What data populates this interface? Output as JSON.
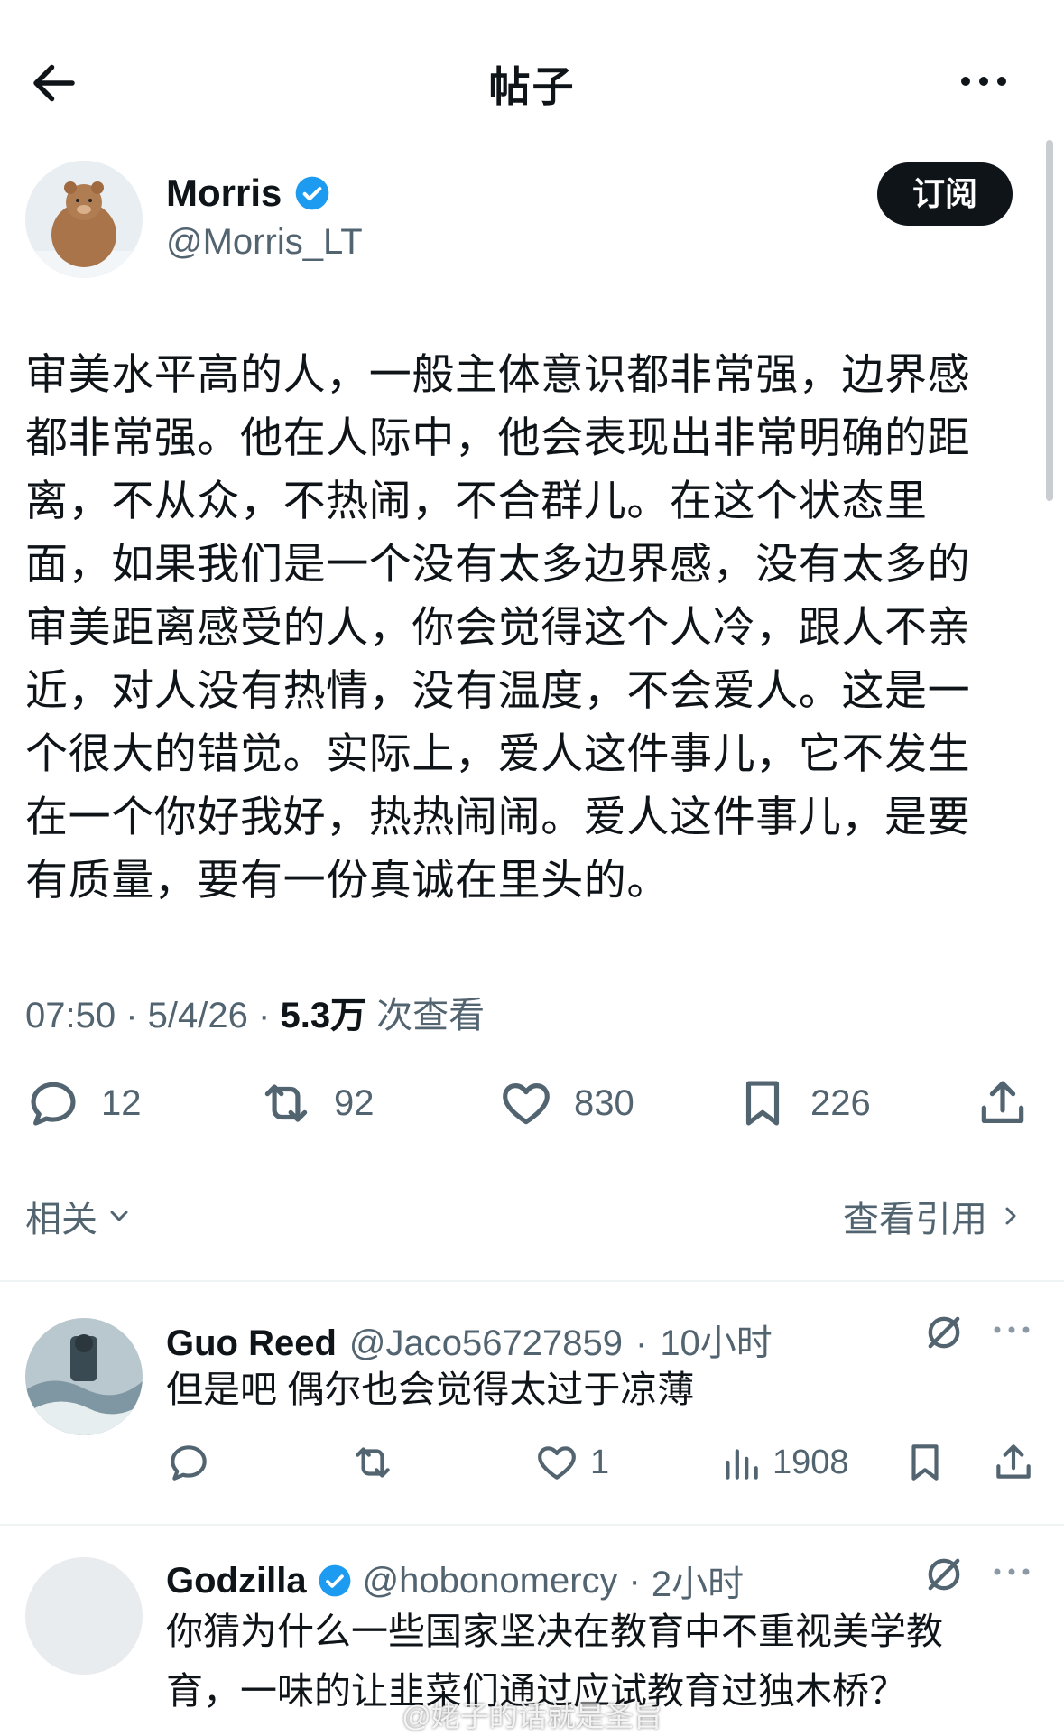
{
  "header": {
    "title": "帖子"
  },
  "post": {
    "author_name": "Morris",
    "author_handle": "@Morris_LT",
    "subscribe_label": "订阅",
    "text": "审美水平高的人，一般主体意识都非常强，边界感\n都非常强。他在人际中，他会表现出非常明确的距\n离，不从众，不热闹，不合群儿。在这个状态里\n面，如果我们是一个没有太多边界感，没有太多的\n审美距离感受的人，你会觉得这个人冷，跟人不亲\n近，对人没有热情，没有温度，不会爱人。这是一\n个很大的错觉。实际上，爱人这件事儿，它不发生\n在一个你好我好，热热闹闹。爱人这件事儿，是要\n有质量，要有一份真诚在里头的。",
    "time": "07:50",
    "date": "5/4/26",
    "views_count": "5.3万",
    "views_label": "次查看",
    "replies": "12",
    "reposts": "92",
    "likes": "830",
    "bookmarks": "226",
    "related_label": "相关",
    "quotes_label": "查看引用"
  },
  "replies": [
    {
      "name": "Guo Reed",
      "handle": "@Jaco56727859",
      "time": "10小时",
      "text": "但是吧 偶尔也会觉得太过于凉薄",
      "likes": "1",
      "views": "1908"
    },
    {
      "name": "Godzilla",
      "handle": "@hobonomercy",
      "time": "2小时",
      "text": "你猜为什么一些国家坚决在教育中不重视美学教\n育，一味的让韭菜们通过应试教育过独木桥？"
    }
  ],
  "watermark": "@姥子的话就是圣旨",
  "colors": {
    "verified": "#1d9bf0",
    "text": "#0f1419",
    "secondary": "#536471",
    "button_bg": "#0f1419"
  }
}
